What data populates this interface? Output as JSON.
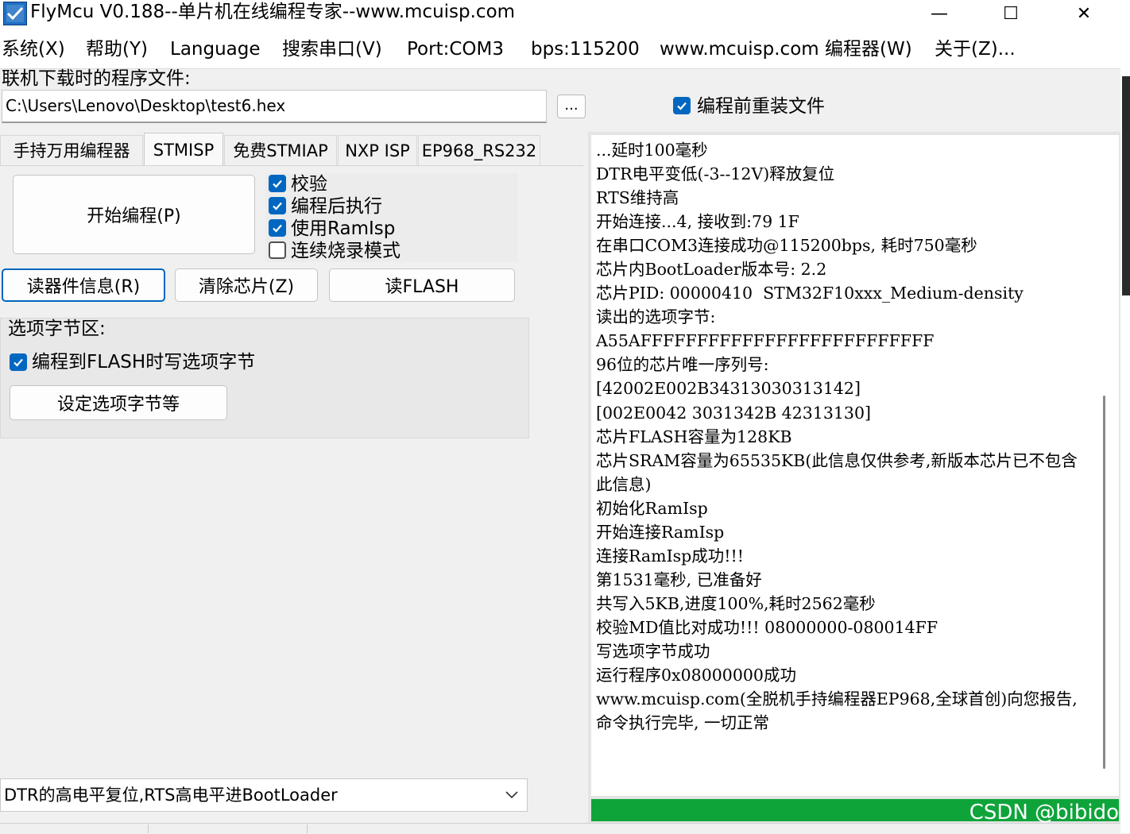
{
  "window": {
    "title": "FlyMcu V0.188--单片机在线编程专家--www.mcuisp.com",
    "minimize_glyph": "—",
    "maximize_glyph": "☐",
    "close_glyph": "✕"
  },
  "menu": {
    "items": [
      "系统(X)",
      "帮助(Y)",
      "Language",
      "搜索串口(V)",
      "Port:COM3",
      "bps:115200",
      "www.mcuisp.com 编程器(W)",
      "关于(Z)..."
    ]
  },
  "file": {
    "label": "联机下载时的程序文件:",
    "path": "C:\\Users\\Lenovo\\Desktop\\test6.hex",
    "browse_label": "...",
    "reload_label": "编程前重装文件",
    "reload_checked": true
  },
  "tabs": {
    "items": [
      "手持万用编程器",
      "STMISP",
      "免费STMIAP",
      "NXP ISP",
      "EP968_RS232"
    ],
    "active": "STMISP"
  },
  "program": {
    "start_label": "开始编程(P)",
    "options": [
      {
        "label": "校验",
        "checked": true
      },
      {
        "label": "编程后执行",
        "checked": true
      },
      {
        "label": "使用RamIsp",
        "checked": true
      },
      {
        "label": "连续烧录模式",
        "checked": false
      }
    ],
    "read_info_label": "读器件信息(R)",
    "erase_label": "清除芯片(Z)",
    "read_flash_label": "读FLASH"
  },
  "option_bytes": {
    "group_label": "选项字节区:",
    "write_label": "编程到FLASH时写选项字节",
    "write_checked": true,
    "set_label": "设定选项字节等"
  },
  "reset_mode": {
    "selected": "DTR的高电平复位,RTS高电平进BootLoader"
  },
  "log": {
    "text": "...延时100毫秒\nDTR电平变低(-3--12V)释放复位\nRTS维持高\n开始连接...4, 接收到:79 1F\n在串口COM3连接成功@115200bps, 耗时750毫秒\n芯片内BootLoader版本号: 2.2\n芯片PID: 00000410  STM32F10xxx_Medium-density\n读出的选项字节:\nA55AFFFFFFFFFFFFFFFFFFFFFFFFFF\n96位的芯片唯一序列号:\n[42002E002B34313030313142]\n[002E0042 3031342B 42313130]\n芯片FLASH容量为128KB\n芯片SRAM容量为65535KB(此信息仅供参考,新版本芯片已不包含此信息)\n初始化RamIsp\n开始连接RamIsp\n连接RamIsp成功!!!\n第1531毫秒, 已准备好\n共写入5KB,进度100%,耗时2562毫秒\n校验MD值比对成功!!! 08000000-080014FF\n写选项字节成功\n运行程序0x08000000成功\nwww.mcuisp.com(全脱机手持编程器EP968,全球首创)向您报告, 命令执行完毕, 一切正常"
  },
  "progress": {
    "fraction": 1.0,
    "color": "#0ea43a"
  },
  "watermark": "CSDN @bibido",
  "colors": {
    "accent": "#0067c0",
    "progress": "#0ea43a"
  }
}
